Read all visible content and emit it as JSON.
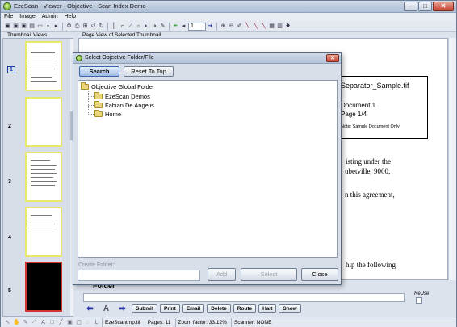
{
  "window": {
    "title": "EzeScan - Viewer - Objective - Scan Index Demo",
    "controls": {
      "minimize": "‒",
      "maximize": "□",
      "close": "✕"
    }
  },
  "menu": [
    "File",
    "Image",
    "Admin",
    "Help"
  ],
  "toolbar": {
    "page_value": "1",
    "icons": [
      "scan-icon",
      "scan-duplex-icon",
      "scan-batch-icon",
      "import-icon",
      "open-folder-icon",
      "save-icon",
      "export-icon",
      "settings-icon",
      "print-icon",
      "zoom-fit-icon",
      "rotate-icon",
      "rotate-right-icon",
      "barcode-icon",
      "crop-icon",
      "deskew-icon",
      "brightness-icon",
      "contrast-icon",
      "invert-icon",
      "edit-icon",
      "marker-icon",
      "prev-page-icon",
      "next-page-icon",
      "zoom-in-icon",
      "zoom-out-icon",
      "annotate-icon",
      "pen-icon",
      "eraser-icon",
      "delete-icon",
      "compress-icon",
      "ocr-icon",
      "effects-icon"
    ]
  },
  "panels": {
    "thumbnail_label": "Thumbnail Views",
    "view_label": "Page View of Selected Thumbnail"
  },
  "thumbnails": [
    {
      "number": "1",
      "selected": true,
      "kind": "document"
    },
    {
      "number": "2",
      "selected": false,
      "kind": "blank"
    },
    {
      "number": "3",
      "selected": false,
      "kind": "document"
    },
    {
      "number": "4",
      "selected": false,
      "kind": "document"
    },
    {
      "number": "5",
      "selected": false,
      "kind": "black"
    }
  ],
  "viewer": {
    "separator_card": {
      "line1": "Separator_Sample.tif",
      "line2": "Document 1",
      "line3": "Page 1/4",
      "line4": "Note: Sample Document Only"
    },
    "text_fragments": [
      "isting under the",
      "ubetville, 9000,",
      "n this agreement,",
      "hip the following"
    ]
  },
  "bottom": {
    "folder_label": "Folder",
    "reuse_label": "ReUse",
    "buttons": [
      "Submit",
      "Print",
      "Email",
      "Delete",
      "Route",
      "Halt",
      "Show"
    ]
  },
  "status": {
    "file": "EzeScantmp.tif",
    "pages": "Pages: 11",
    "zoom": "Zoom factor: 33.12%",
    "scanner": "Scanner: NONE"
  },
  "dialog": {
    "title": "Select Objective Folder/File",
    "search": "Search",
    "reset": "Reset To Top",
    "tree": {
      "root": "Objective Global Folder",
      "children": [
        "EzeScan Demos",
        "Fabian De Angelis",
        "Home"
      ]
    },
    "create_folder_label": "Create Folder:",
    "create_folder_value": "",
    "add": "Add",
    "select": "Select",
    "close": "Close",
    "close_icon": "✕"
  },
  "colors": {
    "thumbnail_border": "#e8e86a",
    "black_thumb_border": "#d0342a",
    "active_button": "#9fbbe6",
    "nav_arrow": "#1e2a9e"
  }
}
